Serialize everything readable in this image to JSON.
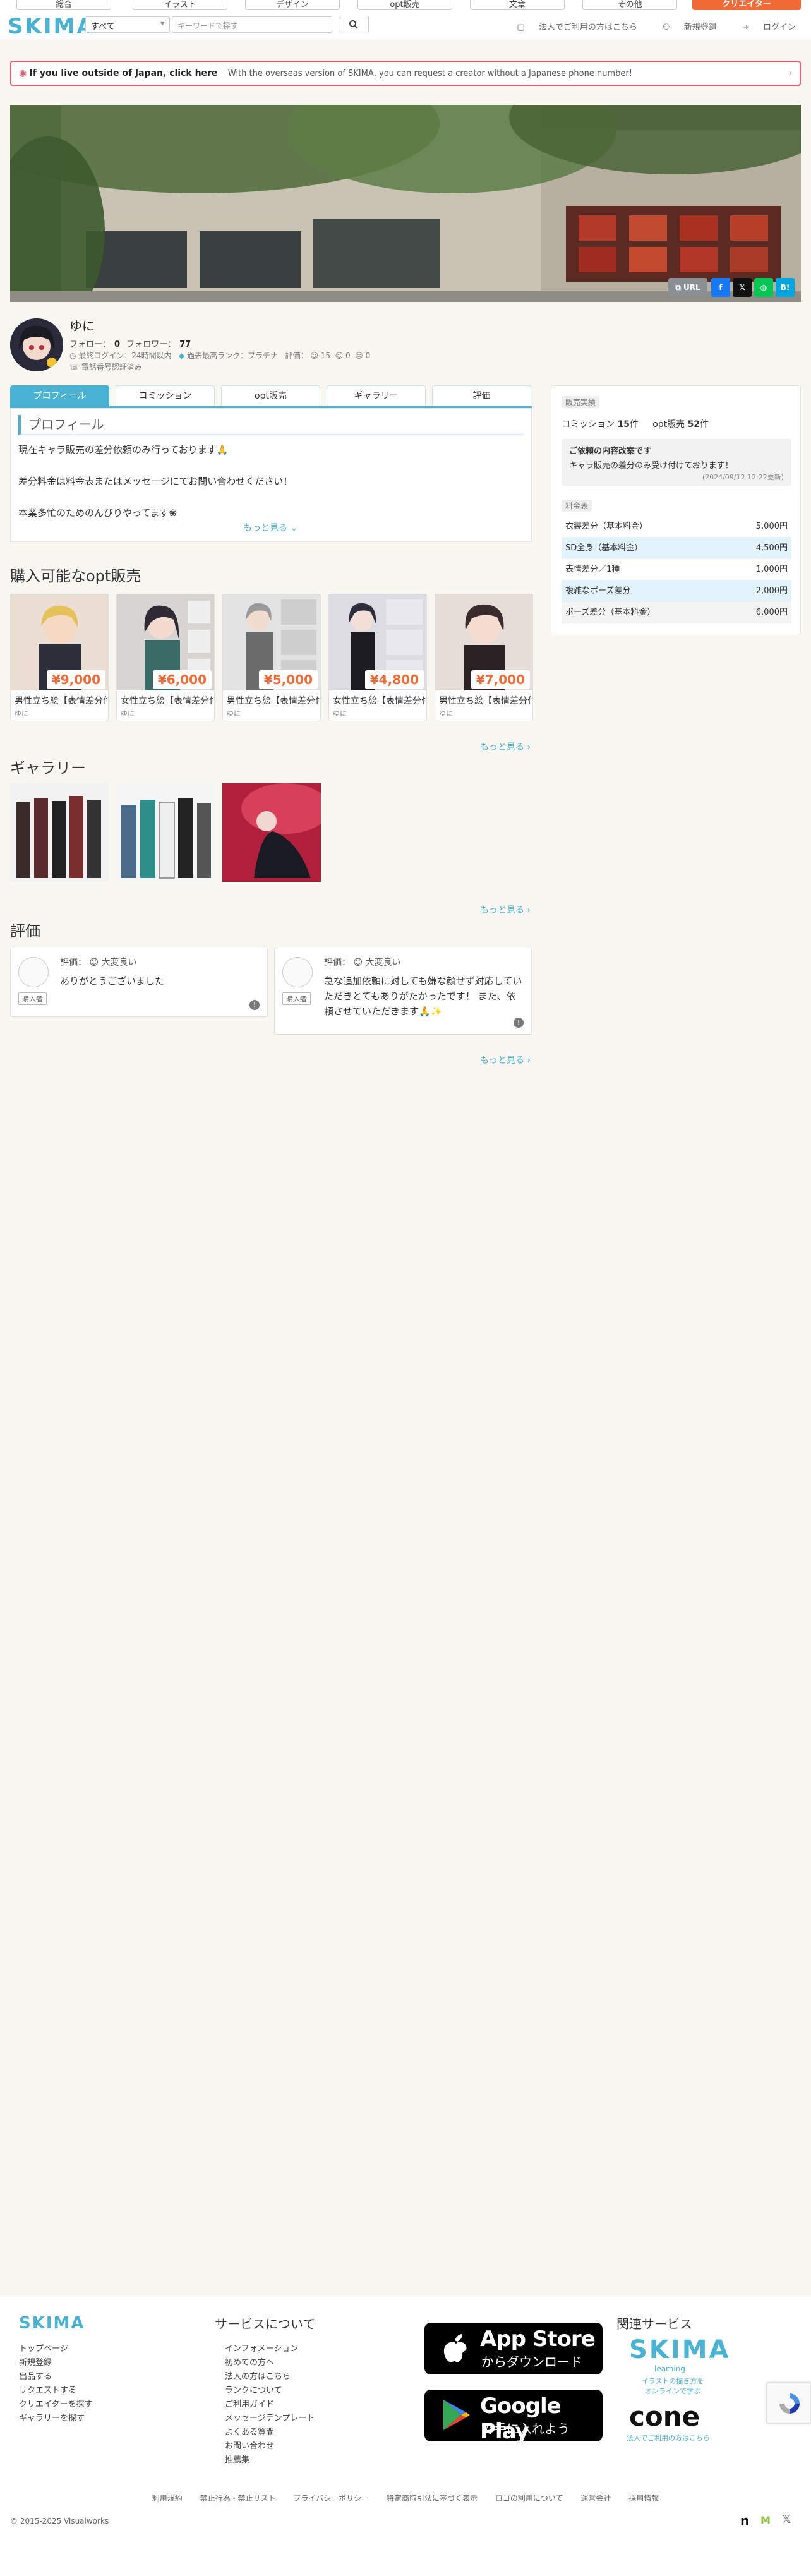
{
  "topnav": {
    "categories": [
      "総合",
      "イラスト",
      "デザイン",
      "opt販売",
      "文章",
      "その他"
    ],
    "cta": "クリエイター"
  },
  "header": {
    "logo": "SKIMA",
    "category_select": "すべて",
    "search_placeholder": "キーワードで探す",
    "corp_link": "法人でご利用の方はこちら",
    "register": "新規登録",
    "login": "ログイン"
  },
  "banner": {
    "bold": "If you live outside of Japan, click here",
    "text": "With the overseas version of SKIMA, you can request a creator without a Japanese phone number!"
  },
  "share": {
    "url_label": "URL",
    "b_label": "B!"
  },
  "profile": {
    "name": "ゆに",
    "follow_label": "フォロー：",
    "follow_count": "0",
    "follower_label": "フォロワー：",
    "follower_count": "77",
    "last_login": "最終ログイン：24時間以内",
    "rank": "過去最高ランク：プラチナ",
    "rating_label": "評価：",
    "rating_good": "15",
    "rating_normal": "0",
    "rating_bad": "0",
    "phone_verified": "電話番号認証済み"
  },
  "tabs": [
    "プロフィール",
    "コミッション",
    "opt販売",
    "ギャラリー",
    "評価"
  ],
  "profile_box": {
    "title": "プロフィール",
    "lines": [
      "現在キャラ販売の差分依頼のみ行っております🙏",
      "差分料金は料金表またはメッセージにてお問い合わせください！",
      "本業多忙のためのんびりやってます❀"
    ],
    "more": "もっと見る ⌄"
  },
  "side": {
    "sales_label": "販売実績",
    "commission_label": "コミッション",
    "commission_count": "15",
    "opt_label": "opt販売",
    "opt_count": "52",
    "unit": "件",
    "notice_title": "ご依頼の内容改案です",
    "notice_body": "キャラ販売の差分のみ受け付けております！",
    "notice_date": "(2024/09/12 12:22更新)",
    "price_label": "料金表",
    "prices": [
      {
        "name": "衣装差分（基本料金）",
        "value": "5,000円"
      },
      {
        "name": "SD全身（基本料金）",
        "value": "4,500円"
      },
      {
        "name": "表情差分／1種",
        "value": "1,000円"
      },
      {
        "name": "複雑なポーズ差分",
        "value": "2,000円"
      },
      {
        "name": "ポーズ差分（基本料金）",
        "value": "6,000円"
      }
    ]
  },
  "opt": {
    "heading": "購入可能なopt販売",
    "items": [
      {
        "title": "男性立ち絵【表情差分付き】",
        "price": "¥9,000",
        "author": "ゆに"
      },
      {
        "title": "女性立ち絵【表情差分付き】",
        "price": "¥6,000",
        "author": "ゆに"
      },
      {
        "title": "男性立ち絵【表情差分付き】",
        "price": "¥5,000",
        "author": "ゆに"
      },
      {
        "title": "女性立ち絵【表情差分付き】",
        "price": "¥4,800",
        "author": "ゆに"
      },
      {
        "title": "男性立ち絵【表情差分付き】",
        "price": "¥7,000",
        "author": "ゆに"
      }
    ],
    "more": "もっと見る ›"
  },
  "gallery": {
    "heading": "ギャラリー",
    "more": "もっと見る ›"
  },
  "reviews": {
    "heading": "評価",
    "rating_prefix": "評価：",
    "items": [
      {
        "rating": "大変良い",
        "text": "ありがとうございました",
        "buyer": "購入者"
      },
      {
        "rating": "大変良い",
        "text": "急な追加依頼に対しても嫌な顔せず対応していただきとてもありがたかったです！ また、依頼させていただきます🙏✨",
        "buyer": "購入者"
      }
    ],
    "more": "もっと見る ›"
  },
  "footer": {
    "logo": "SKIMA",
    "links_left": [
      "トップページ",
      "新規登録",
      "出品する",
      "リクエストする",
      "クリエイターを探す",
      "ギャラリーを探す"
    ],
    "services_title": "サービスについて",
    "links_services": [
      "インフォメーション",
      "初めての方へ",
      "法人の方はこちら",
      "ランクについて",
      "ご利用ガイド",
      "メッセージテンプレート",
      "よくある質問",
      "お問い合わせ",
      "推薦集"
    ],
    "appstore_line1": "App Store",
    "appstore_line2": "からダウンロード",
    "googleplay_line1": "Google Play",
    "googleplay_line2": "で手に入れよう",
    "related_title": "関連サービス",
    "skima_learning": "SKIMA",
    "learning_sub": "learning",
    "learning_desc": "イラストの描き方を オンラインで学ぶ",
    "cone": "cone",
    "cone_desc": "法人でご利用の方はこちら",
    "bottom_links": [
      "利用規約",
      "禁止行為・禁止リスト",
      "プライバシーポリシー",
      "特定商取引法に基づく表示",
      "ロゴの利用について",
      "運営会社",
      "採用情報"
    ],
    "copyright": "© 2015-2025 Visualworks"
  },
  "colors": {
    "accent": "#4ab3d3",
    "brand_orange": "#f26b37",
    "banner_border": "#e8596d"
  }
}
